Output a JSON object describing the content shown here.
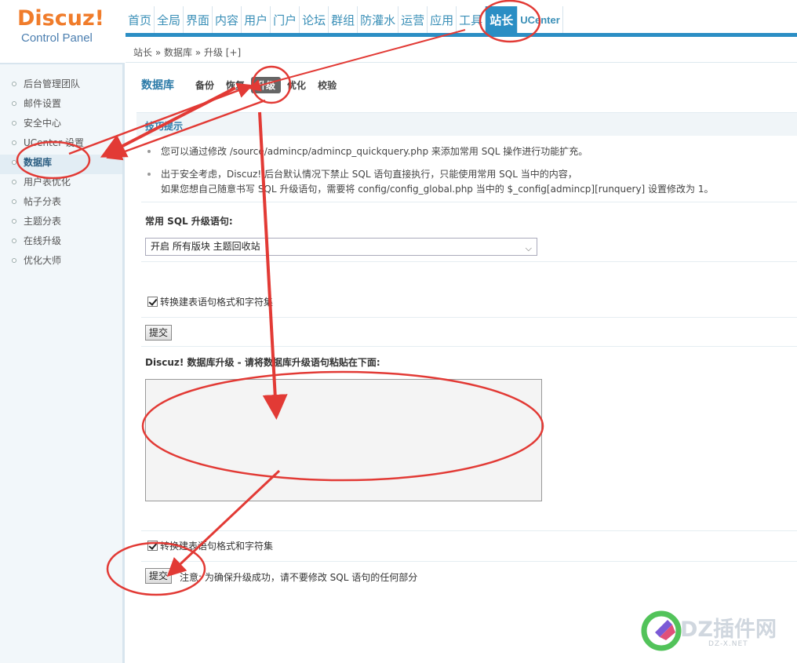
{
  "logo": {
    "title": "Discuz!",
    "subtitle": "Control Panel"
  },
  "nav": {
    "items": [
      "首页",
      "全局",
      "界面",
      "内容",
      "用户",
      "门户",
      "论坛",
      "群组",
      "防灌水",
      "运营",
      "应用",
      "工具",
      "站长",
      "UCenter"
    ],
    "active": "站长"
  },
  "breadcrumb": "站长 » 数据库 » 升级  [+]",
  "sidebar": {
    "items": [
      "后台管理团队",
      "邮件设置",
      "安全中心",
      "UCenter 设置",
      "数据库",
      "用户表优化",
      "帖子分表",
      "主题分表",
      "在线升级",
      "优化大师"
    ],
    "active": "数据库"
  },
  "tabs": {
    "title": "数据库",
    "items": [
      "备份",
      "恢复",
      "升级",
      "优化",
      "校验"
    ],
    "active": "升级"
  },
  "tips": {
    "header": "技巧提示",
    "line1": "您可以通过修改 /source/admincp/admincp_quickquery.php 来添加常用 SQL 操作进行功能扩充。",
    "line2a": "出于安全考虑，Discuz! 后台默认情况下禁止 SQL 语句直接执行，只能使用常用 SQL 当中的内容，",
    "line2b": "如果您想自己随意书写 SQL 升级语句，需要将 config/config_global.php 当中的 $_config[admincp][runquery] 设置修改为 1。"
  },
  "common_sql": {
    "label": "常用 SQL 升级语句:",
    "selected": "开启 所有版块 主题回收站",
    "convert_label": "转换建表语句格式和字符集",
    "submit": "提交"
  },
  "upgrade": {
    "label": "Discuz! 数据库升级 - 请将数据库升级语句粘贴在下面:",
    "convert_label": "转换建表语句格式和字符集",
    "submit": "提交",
    "note": "注意: 为确保升级成功，请不要修改 SQL 语句的任何部分"
  },
  "watermark": {
    "text": "DZ插件网",
    "sub": "DZ-X.NET"
  },
  "colors": {
    "accent": "#2b8ec4",
    "annotation": "#e23a35",
    "logo": "#f07c2b"
  }
}
